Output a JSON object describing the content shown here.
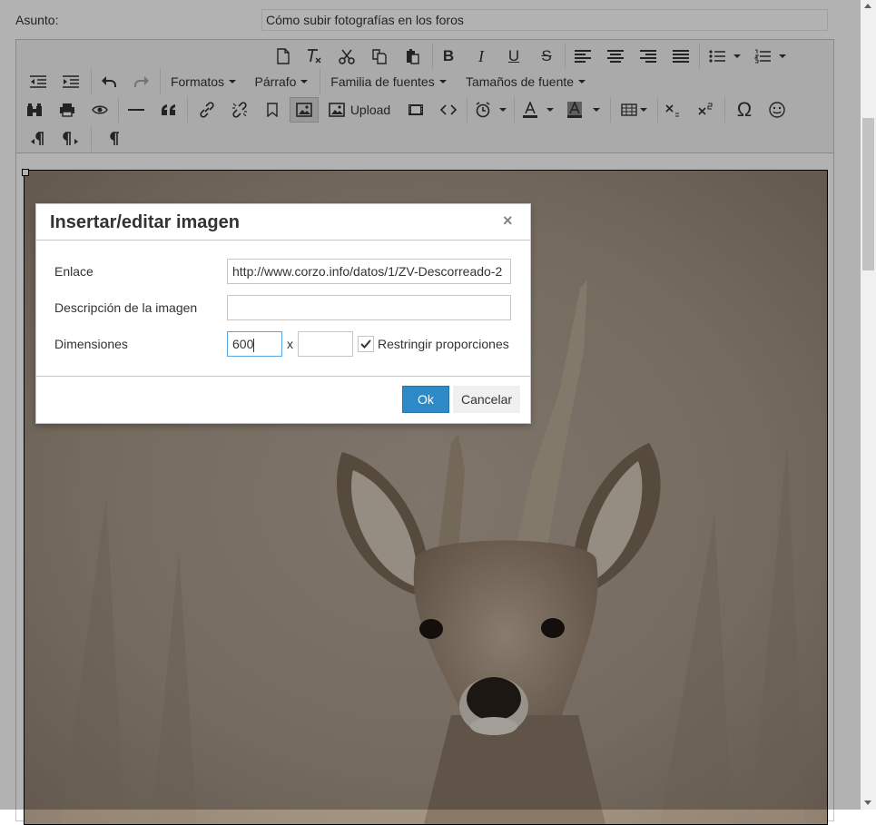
{
  "form": {
    "subject_label": "Asunto:",
    "subject_value": "Cómo subir fotografías en los foros"
  },
  "toolbar": {
    "formats": "Formatos",
    "paragraph": "Párrafo",
    "font_family": "Familia de fuentes",
    "font_sizes": "Tamaños de fuente",
    "upload": "Upload",
    "quote_glyph": "66",
    "omega_glyph": "Ω"
  },
  "dialog": {
    "title": "Insertar/editar imagen",
    "close_glyph": "×",
    "source_label": "Enlace",
    "source_value": "http://www.corzo.info/datos/1/ZV-Descorreado-2",
    "description_label": "Descripción de la imagen",
    "description_value": "",
    "dimensions_label": "Dimensiones",
    "width_value": "600",
    "height_value": "",
    "dimension_separator": "x",
    "constrain_label": "Restringir proporciones",
    "constrain_checked": true,
    "ok_label": "Ok",
    "cancel_label": "Cancelar"
  },
  "colors": {
    "ok_button": "#2d8ac7",
    "overlay": "rgba(0,0,0,0.3)",
    "focus_border": "#59a5e5"
  },
  "image": {
    "subject": "roe deer buck portrait"
  }
}
